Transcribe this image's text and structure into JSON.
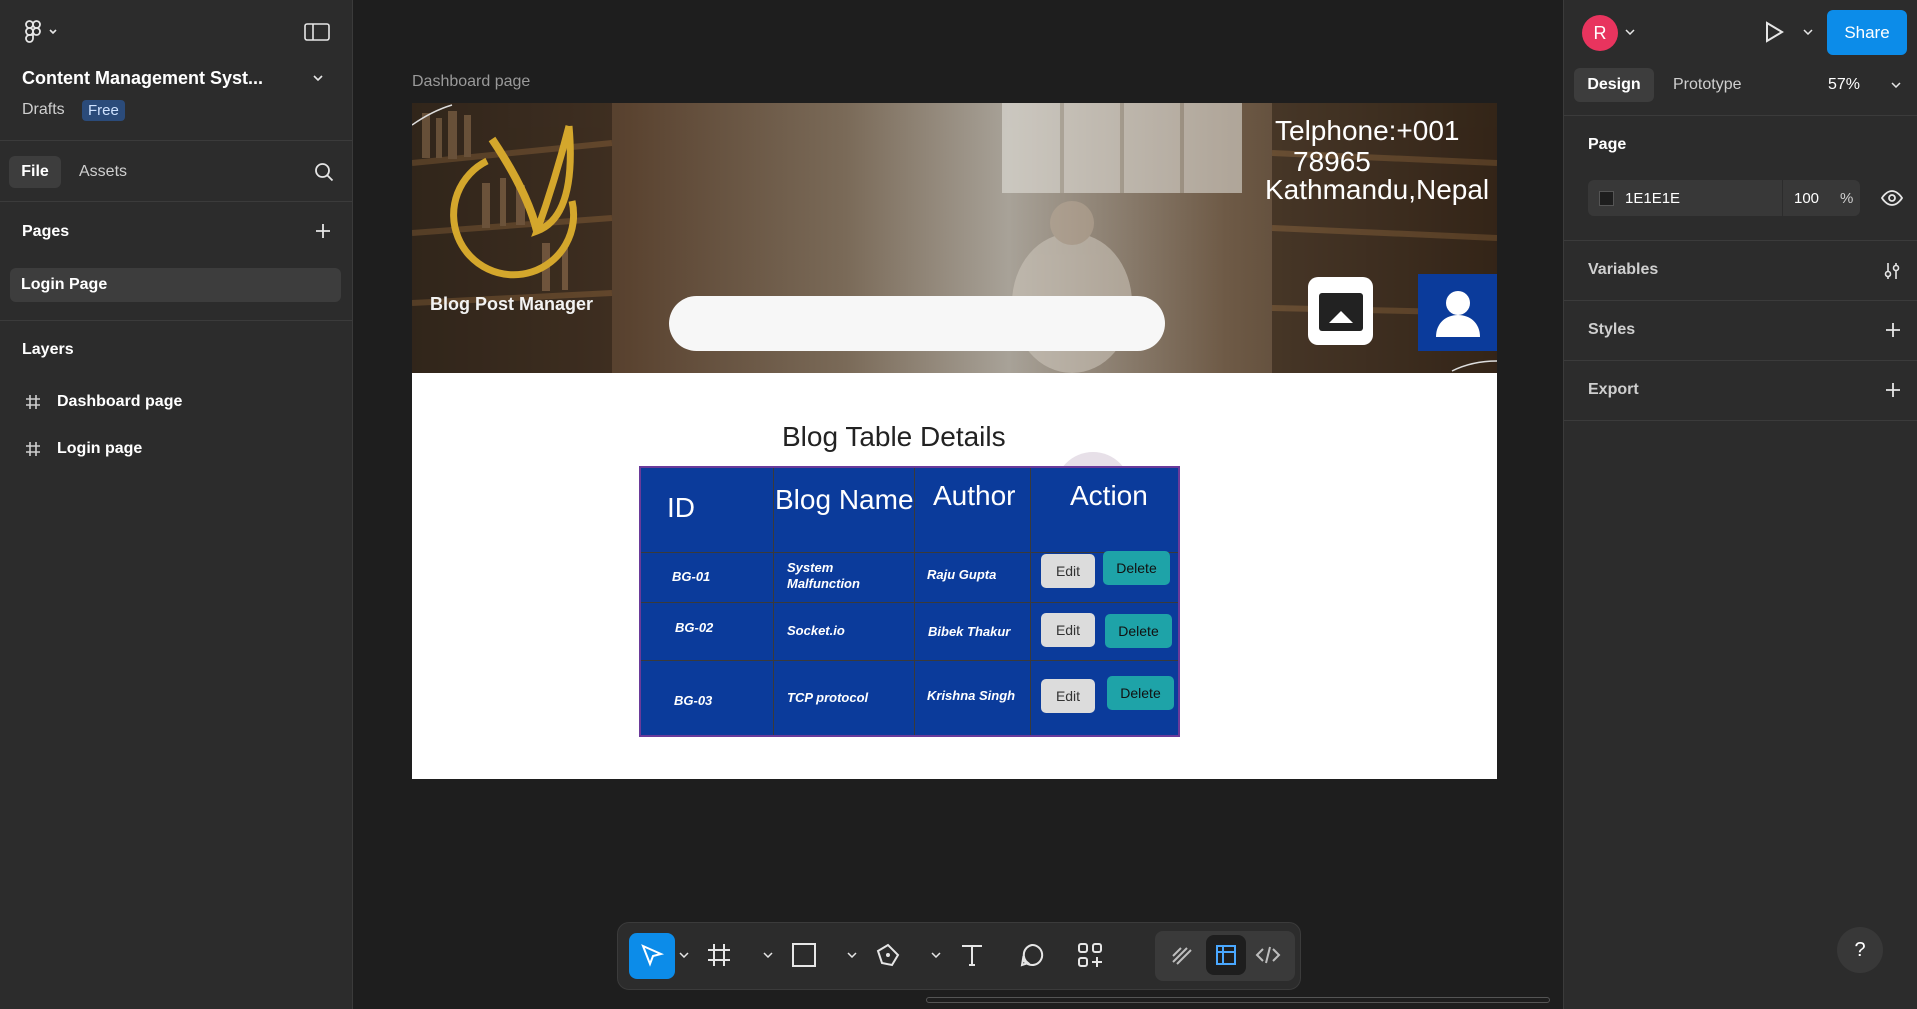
{
  "left": {
    "file_name": "Content Management Syst...",
    "drafts": "Drafts",
    "plan_badge": "Free",
    "tabs": [
      "File",
      "Assets"
    ],
    "pages_heading": "Pages",
    "pages": [
      "Login Page"
    ],
    "layers_heading": "Layers",
    "layers": [
      "Dashboard page",
      "Login page"
    ]
  },
  "right": {
    "avatar_letter": "R",
    "share_label": "Share",
    "tabs": [
      "Design",
      "Prototype"
    ],
    "zoom": "57%",
    "page_heading": "Page",
    "page_color": "1E1E1E",
    "page_opacity": "100",
    "percent": "%",
    "variables": "Variables",
    "styles": "Styles",
    "export": "Export"
  },
  "canvas": {
    "frame_label": "Dashboard page",
    "brand": "Blog Post Manager",
    "contact_line1": "Telphone:+001",
    "contact_line2": "78965",
    "contact_line3": "Kathmandu,Nepal",
    "table_title": "Blog Table Details",
    "headers": [
      "ID",
      "Blog Name",
      "Author",
      "Action"
    ],
    "rows": [
      {
        "id": "BG-01",
        "name": "System Malfunction",
        "author": "Raju Gupta"
      },
      {
        "id": "BG-02",
        "name": "Socket.io",
        "author": "Bibek Thakur"
      },
      {
        "id": "BG-03",
        "name": "TCP protocol",
        "author": "Krishna Singh"
      }
    ],
    "edit_label": "Edit",
    "delete_label": "Delete"
  },
  "help": "?",
  "colors": {
    "accent": "#0c8ce9",
    "table_bg": "#0b3b9b",
    "delete_btn": "#1ea3a8",
    "logo_gold": "#d4a72c",
    "avatar": "#e8345e"
  }
}
